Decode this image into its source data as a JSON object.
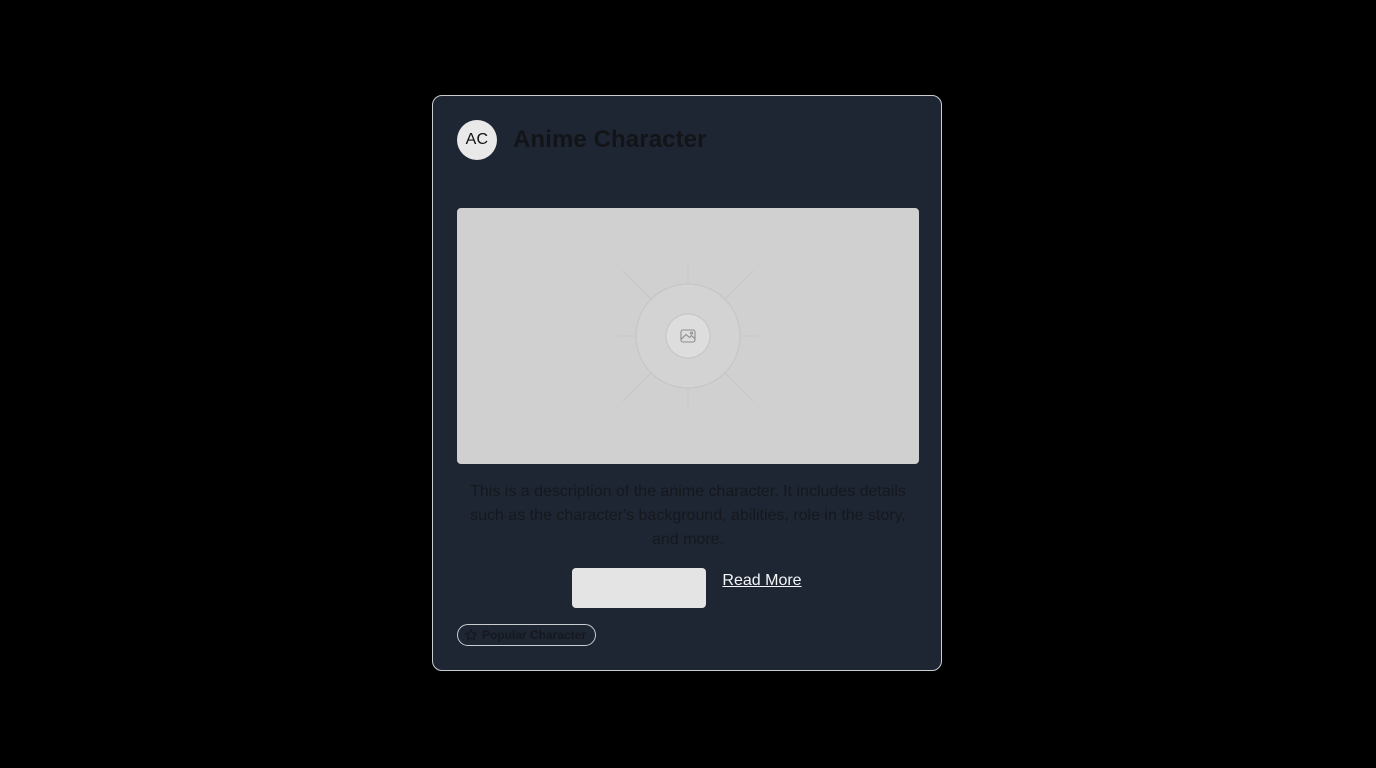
{
  "card": {
    "avatar_initials": "AC",
    "title": "Anime Character",
    "image": {
      "icon": "image-placeholder-icon"
    },
    "description": "This is a description of the anime character. It includes details such as the character's background, abilities, role in the story, and more.",
    "primary_button_label": "",
    "read_more_label": "Read More",
    "badge": {
      "icon": "star-icon",
      "label": "Popular Character"
    }
  },
  "colors": {
    "page_background": "#000000",
    "card_background": "#1e2633",
    "card_border": "#c9ccd1",
    "image_placeholder": "#d0d0d0",
    "button_background": "#e4e4e4",
    "title_text": "#121418",
    "link_text": "#f4f5f7"
  }
}
